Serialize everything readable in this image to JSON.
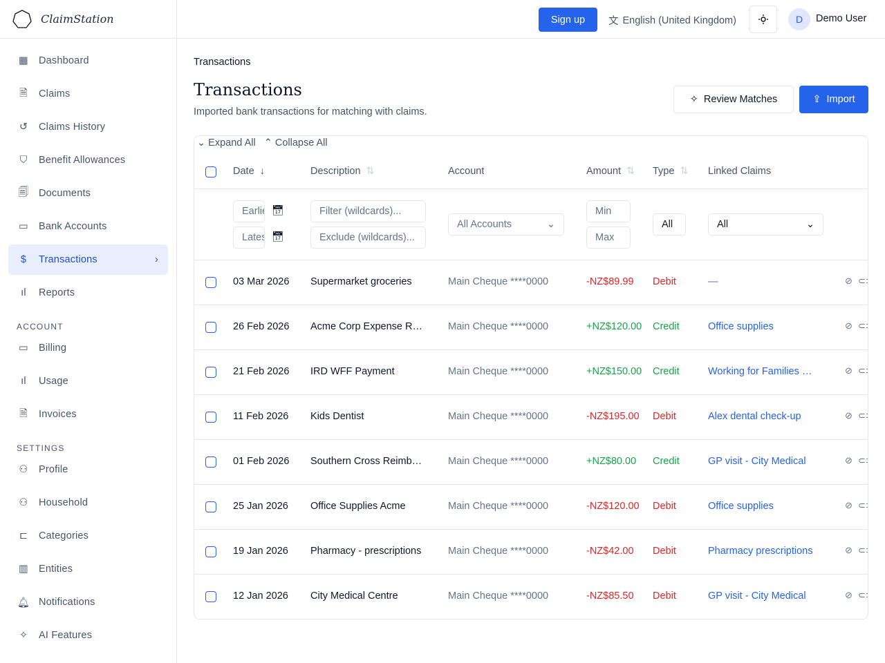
{
  "app": {
    "name": "ClaimStation"
  },
  "sidebar": {
    "items": [
      {
        "label": "Dashboard",
        "icon": "dashboard-icon"
      },
      {
        "label": "Claims",
        "icon": "file-icon"
      },
      {
        "label": "Claims History",
        "icon": "history-icon"
      },
      {
        "label": "Benefit Allowances",
        "icon": "shield-icon"
      },
      {
        "label": "Documents",
        "icon": "documents-icon"
      },
      {
        "label": "Bank Accounts",
        "icon": "bank-icon"
      },
      {
        "label": "Transactions",
        "icon": "dollar-icon",
        "active": true
      },
      {
        "label": "Reports",
        "icon": "chart-icon"
      }
    ],
    "account_label": "ACCOUNT",
    "account_items": [
      {
        "label": "Billing"
      },
      {
        "label": "Usage"
      },
      {
        "label": "Invoices"
      }
    ],
    "settings_label": "SETTINGS",
    "settings_items": [
      {
        "label": "Profile"
      },
      {
        "label": "Household"
      },
      {
        "label": "Categories"
      },
      {
        "label": "Entities"
      },
      {
        "label": "Notifications"
      },
      {
        "label": "AI Features"
      }
    ]
  },
  "topbar": {
    "signup": "Sign up",
    "language": "English (United Kingdom)",
    "avatar_initial": "D",
    "user": "Demo User"
  },
  "page": {
    "breadcrumb": "Transactions",
    "title": "Transactions",
    "subtitle": "Imported bank transactions for matching with claims.",
    "review": "Review Matches",
    "import": "Import"
  },
  "table": {
    "expand": "Expand All",
    "collapse": "Collapse All",
    "headers": {
      "date": "Date",
      "description": "Description",
      "account": "Account",
      "amount": "Amount",
      "type": "Type",
      "linked": "Linked Claims"
    },
    "filters": {
      "earliest": "Earliest",
      "latest": "Latest",
      "filter_ph": "Filter (wildcards)...",
      "exclude_ph": "Exclude (wildcards)...",
      "account": "All Accounts",
      "min": "Min",
      "max": "Max",
      "type": "All",
      "linked": "All"
    },
    "rows": [
      {
        "date": "03 Mar 2026",
        "description": "Supermarket groceries",
        "account": "Main Cheque ****0000",
        "amount": "-NZ$89.99",
        "type": "Debit",
        "linked": "—"
      },
      {
        "date": "26 Feb 2026",
        "description": "Acme Corp Expense Reimbursement",
        "account": "Main Cheque ****0000",
        "amount": "+NZ$120.00",
        "type": "Credit",
        "linked": "Office supplies"
      },
      {
        "date": "21 Feb 2026",
        "description": "IRD WFF Payment",
        "account": "Main Cheque ****0000",
        "amount": "+NZ$150.00",
        "type": "Credit",
        "linked": "Working for Families payment"
      },
      {
        "date": "11 Feb 2026",
        "description": "Kids Dentist",
        "account": "Main Cheque ****0000",
        "amount": "-NZ$195.00",
        "type": "Debit",
        "linked": "Alex dental check-up"
      },
      {
        "date": "01 Feb 2026",
        "description": "Southern Cross Reimbursement",
        "account": "Main Cheque ****0000",
        "amount": "+NZ$80.00",
        "type": "Credit",
        "linked": "GP visit - City Medical"
      },
      {
        "date": "25 Jan 2026",
        "description": "Office Supplies Acme",
        "account": "Main Cheque ****0000",
        "amount": "-NZ$120.00",
        "type": "Debit",
        "linked": "Office supplies"
      },
      {
        "date": "19 Jan 2026",
        "description": "Pharmacy - prescriptions",
        "account": "Main Cheque ****0000",
        "amount": "-NZ$42.00",
        "type": "Debit",
        "linked": "Pharmacy prescriptions"
      },
      {
        "date": "12 Jan 2026",
        "description": "City Medical Centre",
        "account": "Main Cheque ****0000",
        "amount": "-NZ$85.50",
        "type": "Debit",
        "linked": "GP visit - City Medical"
      }
    ]
  },
  "colors": {
    "accent": "#2563eb",
    "debit": "#dc2626",
    "credit": "#16a34a"
  }
}
